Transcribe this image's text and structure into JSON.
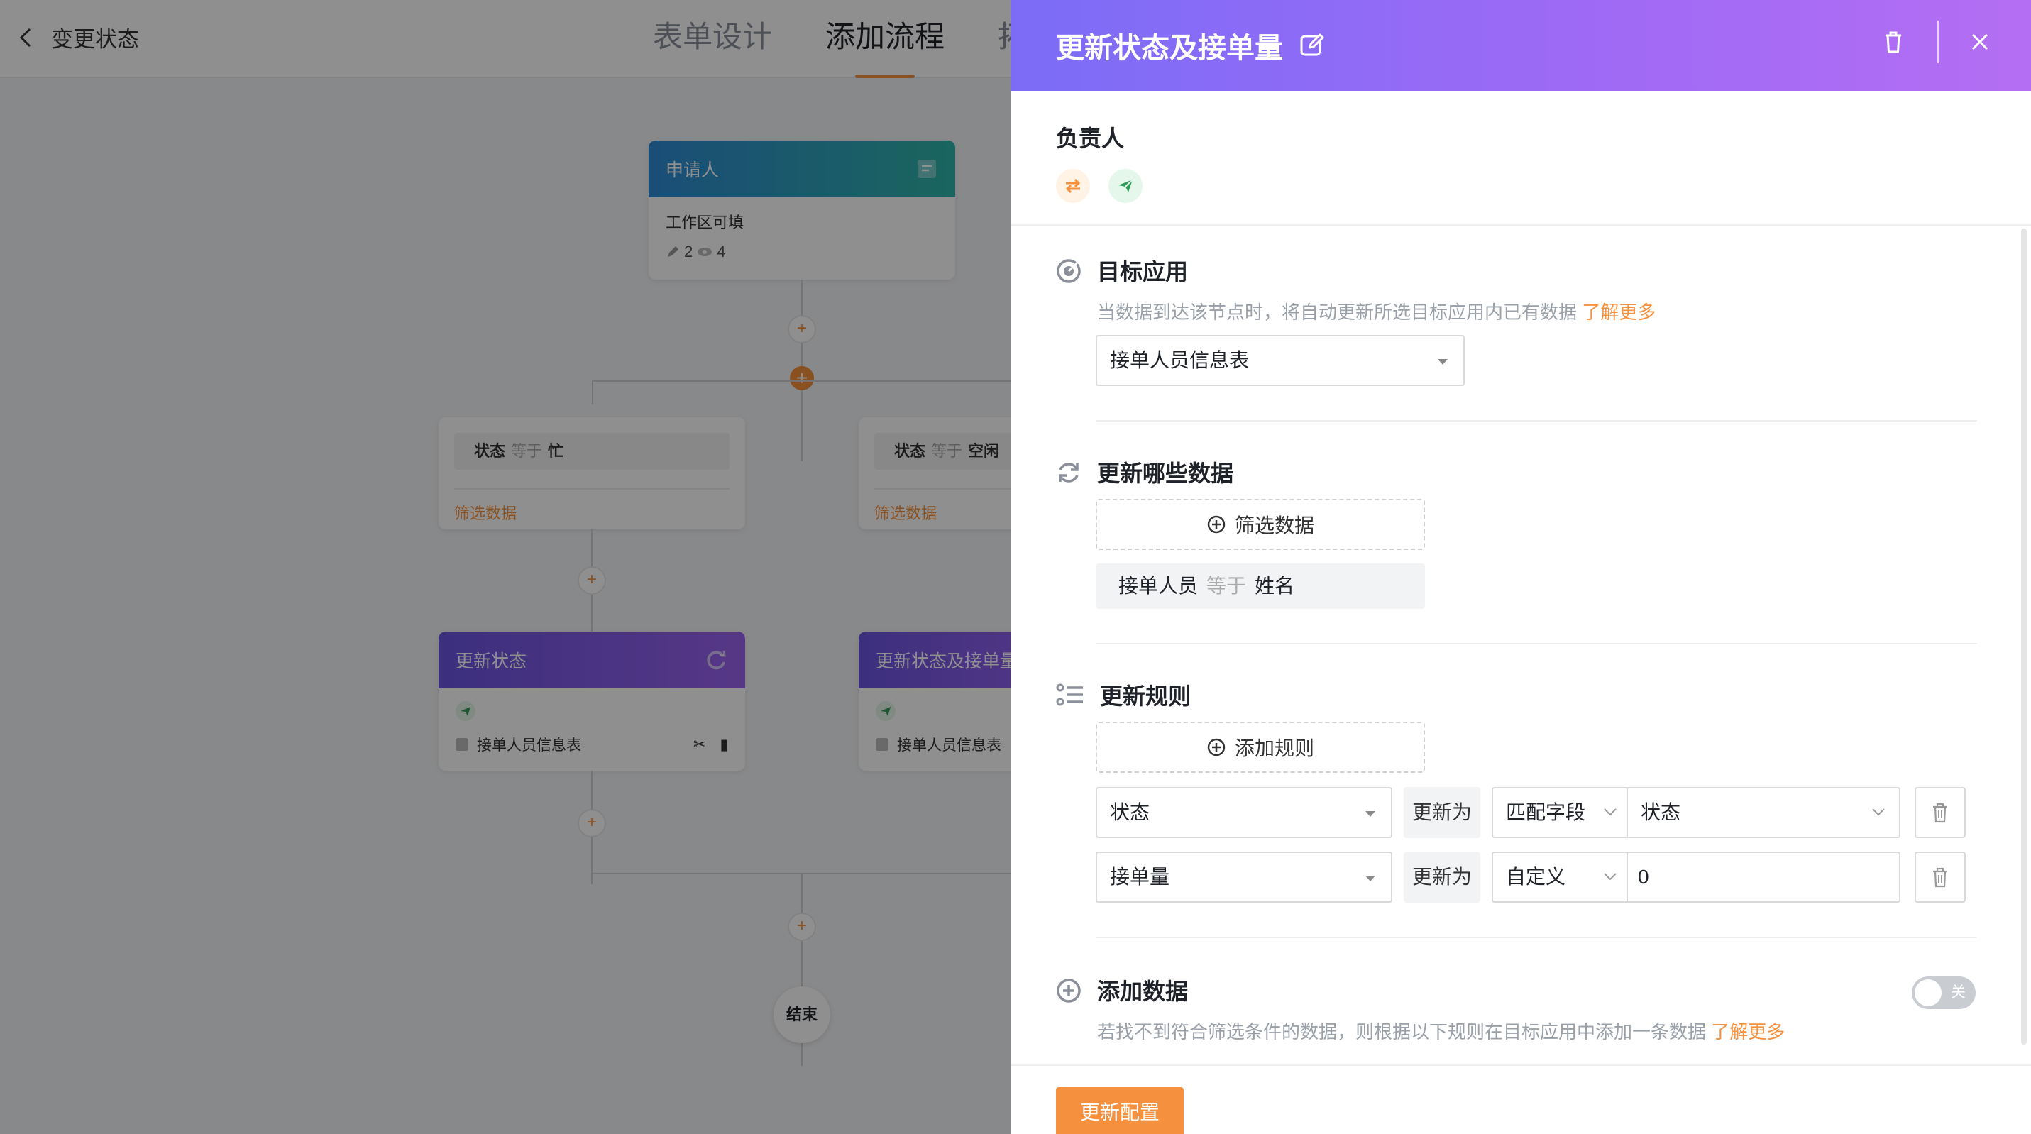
{
  "app": {
    "back_title": "变更状态",
    "tabs": [
      {
        "label": "表单设计",
        "active": false
      },
      {
        "label": "添加流程",
        "active": true
      },
      {
        "label": "拓",
        "active": false
      }
    ]
  },
  "flow": {
    "start_node": {
      "title": "申请人",
      "desc": "工作区可填",
      "edit_count": "2",
      "view_count": "4"
    },
    "branches": [
      {
        "field": "状态",
        "op": "等于",
        "value": "忙",
        "filter_link": "筛选数据"
      },
      {
        "field": "状态",
        "op": "等于",
        "value": "空闲",
        "filter_link": "筛选数据"
      }
    ],
    "action_nodes": [
      {
        "title": "更新状态",
        "table": "接单人员信息表"
      },
      {
        "title": "更新状态及接单量",
        "table": "接单人员信息表"
      }
    ],
    "end_label": "结束"
  },
  "drawer": {
    "title": "更新状态及接单量",
    "owner_label": "负责人",
    "target_app": {
      "title": "目标应用",
      "desc": "当数据到达该节点时，将自动更新所选目标应用内已有数据",
      "link": "了解更多",
      "selected": "接单人员信息表"
    },
    "which_data": {
      "title": "更新哪些数据",
      "filter_button": "筛选数据",
      "filter": {
        "field": "接单人员",
        "op": "等于",
        "value": "姓名"
      }
    },
    "rules": {
      "title": "更新规则",
      "add_button": "添加规则",
      "items": [
        {
          "field": "状态",
          "update_label": "更新为",
          "mode": "匹配字段",
          "value": "状态"
        },
        {
          "field": "接单量",
          "update_label": "更新为",
          "mode": "自定义",
          "value": "0"
        }
      ]
    },
    "add_data": {
      "title": "添加数据",
      "desc": "若找不到符合筛选条件的数据，则根据以下规则在目标应用中添加一条数据",
      "link": "了解更多",
      "toggle_label": "关",
      "enabled": false
    },
    "submit_label": "更新配置"
  },
  "colors": {
    "accent": "#f5913e",
    "header_start": "#7b6cf6",
    "header_end": "#b46ef3"
  }
}
